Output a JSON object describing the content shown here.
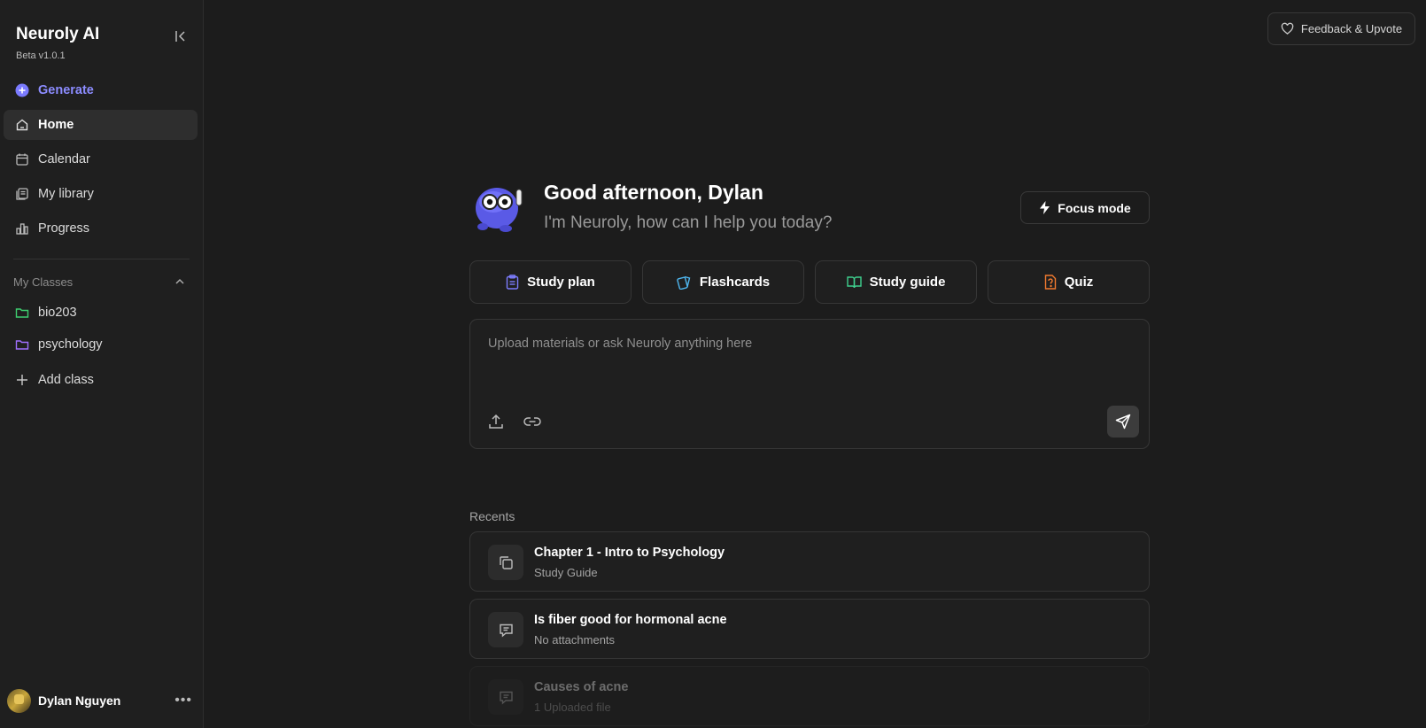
{
  "sidebar": {
    "brand": "Neuroly AI",
    "version": "Beta v1.0.1",
    "generate_label": "Generate",
    "nav": [
      {
        "label": "Home",
        "icon": "home-icon"
      },
      {
        "label": "Calendar",
        "icon": "calendar-icon"
      },
      {
        "label": "My library",
        "icon": "library-icon"
      },
      {
        "label": "Progress",
        "icon": "bar-chart-icon"
      }
    ],
    "classes_label": "My Classes",
    "classes": [
      {
        "label": "bio203",
        "color": "#3fcf70"
      },
      {
        "label": "psychology",
        "color": "#a070ff"
      }
    ],
    "add_class_label": "Add class",
    "user_name": "Dylan Nguyen"
  },
  "header": {
    "feedback_label": "Feedback & Upvote"
  },
  "main": {
    "greeting": "Good afternoon, Dylan",
    "subtitle": "I'm Neuroly, how can I help you today?",
    "focus_label": "Focus mode",
    "chips": [
      {
        "label": "Study plan",
        "color": "#7d7dff"
      },
      {
        "label": "Flashcards",
        "color": "#4fb7f0"
      },
      {
        "label": "Study guide",
        "color": "#3fcf8e"
      },
      {
        "label": "Quiz",
        "color": "#f27a2f"
      }
    ],
    "composer_placeholder": "Upload materials or ask Neuroly anything here",
    "recents_label": "Recents",
    "recents": [
      {
        "title": "Chapter 1 - Intro to Psychology",
        "subtitle": "Study Guide",
        "icon": "copy-icon"
      },
      {
        "title": "Is fiber good for hormonal acne",
        "subtitle": "No attachments",
        "icon": "chat-icon"
      },
      {
        "title": "Causes of acne",
        "subtitle": "1 Uploaded file",
        "icon": "chat-icon"
      }
    ]
  },
  "colors": {
    "accent": "#8c8cff",
    "background": "#1c1c1c",
    "sidebar": "#1f1f1f"
  }
}
